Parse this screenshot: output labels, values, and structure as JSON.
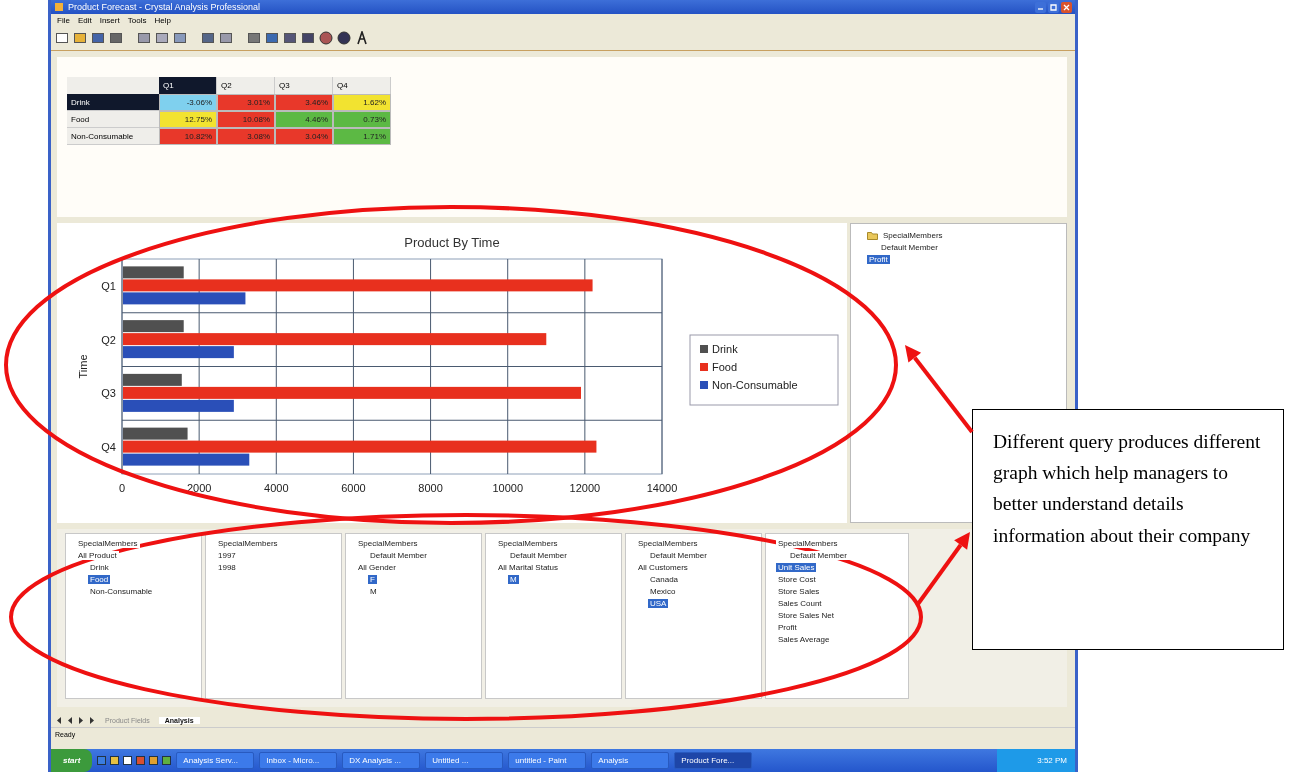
{
  "window": {
    "title": "Product Forecast - Crystal Analysis Professional"
  },
  "menu": [
    "File",
    "Edit",
    "Insert",
    "Tools",
    "Help"
  ],
  "table": {
    "columns": [
      {
        "label": "Q1",
        "selected": true
      },
      {
        "label": "Q2",
        "selected": false
      },
      {
        "label": "Q3",
        "selected": false
      },
      {
        "label": "Q4",
        "selected": false
      }
    ],
    "rows": [
      {
        "label": "Drink",
        "selected": true,
        "cells": [
          {
            "text": "-3.06%",
            "color": "#7fd0ee"
          },
          {
            "text": "3.01%",
            "color": "#e8382a"
          },
          {
            "text": "3.46%",
            "color": "#e8382a"
          },
          {
            "text": "1.62%",
            "color": "#f2e330"
          }
        ]
      },
      {
        "label": "Food",
        "selected": false,
        "cells": [
          {
            "text": "12.75%",
            "color": "#f2e330"
          },
          {
            "text": "10.08%",
            "color": "#e8382a"
          },
          {
            "text": "4.46%",
            "color": "#5cb944"
          },
          {
            "text": "0.73%",
            "color": "#5cb944"
          }
        ]
      },
      {
        "label": "Non-Consumable",
        "selected": false,
        "cells": [
          {
            "text": "10.82%",
            "color": "#e8382a"
          },
          {
            "text": "3.08%",
            "color": "#e8382a"
          },
          {
            "text": "3.04%",
            "color": "#e8382a"
          },
          {
            "text": "1.71%",
            "color": "#5cb944"
          }
        ]
      }
    ]
  },
  "chart": {
    "chart_data": {
      "type": "bar",
      "orientation": "horizontal",
      "title": "Product By Time",
      "ylabel": "Time",
      "categories": [
        "Q1",
        "Q2",
        "Q3",
        "Q4"
      ],
      "series": [
        {
          "name": "Drink",
          "color": "#505050",
          "values": [
            1600,
            1600,
            1550,
            1700
          ]
        },
        {
          "name": "Food",
          "color": "#e8301e",
          "values": [
            12200,
            11000,
            11900,
            12300
          ]
        },
        {
          "name": "Non-Consumable",
          "color": "#2a4fb8",
          "values": [
            3200,
            2900,
            2900,
            3300
          ]
        }
      ],
      "grid": true,
      "legend": true,
      "xlim": [
        0,
        14000
      ],
      "xticks": [
        0,
        2000,
        4000,
        6000,
        8000,
        10000,
        12000,
        14000
      ]
    }
  },
  "side_tree": {
    "nodes": [
      {
        "label": "SpecialMembers",
        "selected": false,
        "children": [
          {
            "label": "Default Member",
            "selected": false
          }
        ]
      },
      {
        "label": "Profit",
        "selected": true
      }
    ]
  },
  "filter_trees": [
    {
      "nodes": [
        {
          "label": "SpecialMembers",
          "selected": false
        },
        {
          "label": "All Product",
          "selected": false,
          "children": [
            {
              "label": "Drink",
              "selected": false
            },
            {
              "label": "Food",
              "selected": true
            },
            {
              "label": "Non-Consumable",
              "selected": false
            }
          ]
        }
      ]
    },
    {
      "nodes": [
        {
          "label": "SpecialMembers",
          "selected": false
        },
        {
          "label": "1997",
          "selected": false
        },
        {
          "label": "1998",
          "selected": false
        }
      ]
    },
    {
      "nodes": [
        {
          "label": "SpecialMembers",
          "selected": false,
          "children": [
            {
              "label": "Default Member",
              "selected": false
            }
          ]
        },
        {
          "label": "All Gender",
          "selected": false,
          "children": [
            {
              "label": "F",
              "selected": true
            },
            {
              "label": "M",
              "selected": false
            }
          ]
        }
      ]
    },
    {
      "nodes": [
        {
          "label": "SpecialMembers",
          "selected": false,
          "children": [
            {
              "label": "Default Member",
              "selected": false
            }
          ]
        },
        {
          "label": "All Marital Status",
          "selected": false,
          "children": [
            {
              "label": "M",
              "selected": true
            }
          ]
        }
      ]
    },
    {
      "nodes": [
        {
          "label": "SpecialMembers",
          "selected": false,
          "children": [
            {
              "label": "Default Member",
              "selected": false
            }
          ]
        },
        {
          "label": "All Customers",
          "selected": false,
          "children": [
            {
              "label": "Canada",
              "selected": false
            },
            {
              "label": "Mexico",
              "selected": false
            },
            {
              "label": "USA",
              "selected": true
            }
          ]
        }
      ]
    },
    {
      "nodes": [
        {
          "label": "SpecialMembers",
          "selected": false,
          "children": [
            {
              "label": "Default Member",
              "selected": false
            }
          ]
        },
        {
          "label": "Unit Sales",
          "selected": true
        },
        {
          "label": "Store Cost",
          "selected": false
        },
        {
          "label": "Store Sales",
          "selected": false
        },
        {
          "label": "Sales Count",
          "selected": false
        },
        {
          "label": "Store Sales Net",
          "selected": false
        },
        {
          "label": "Profit",
          "selected": false
        },
        {
          "label": "Sales Average",
          "selected": false
        }
      ]
    }
  ],
  "sheet_tabs": [
    {
      "label": "Product Fields",
      "selected": false
    },
    {
      "label": "Analysis",
      "selected": true
    }
  ],
  "status_bar": "Ready",
  "taskbar": {
    "start": "start",
    "tasks": [
      {
        "label": "Analysis Serv...",
        "selected": false
      },
      {
        "label": "Inbox - Micro...",
        "selected": false
      },
      {
        "label": "DX Analysis ...",
        "selected": false
      },
      {
        "label": "Untitled ...",
        "selected": false
      },
      {
        "label": "untitled - Paint",
        "selected": false
      },
      {
        "label": "Analysis",
        "selected": false
      },
      {
        "label": "Product Fore...",
        "selected": true
      }
    ],
    "clock": "3:52 PM"
  },
  "callout": {
    "text": "Different query produces different graph which help managers to better understand details information about their company"
  }
}
